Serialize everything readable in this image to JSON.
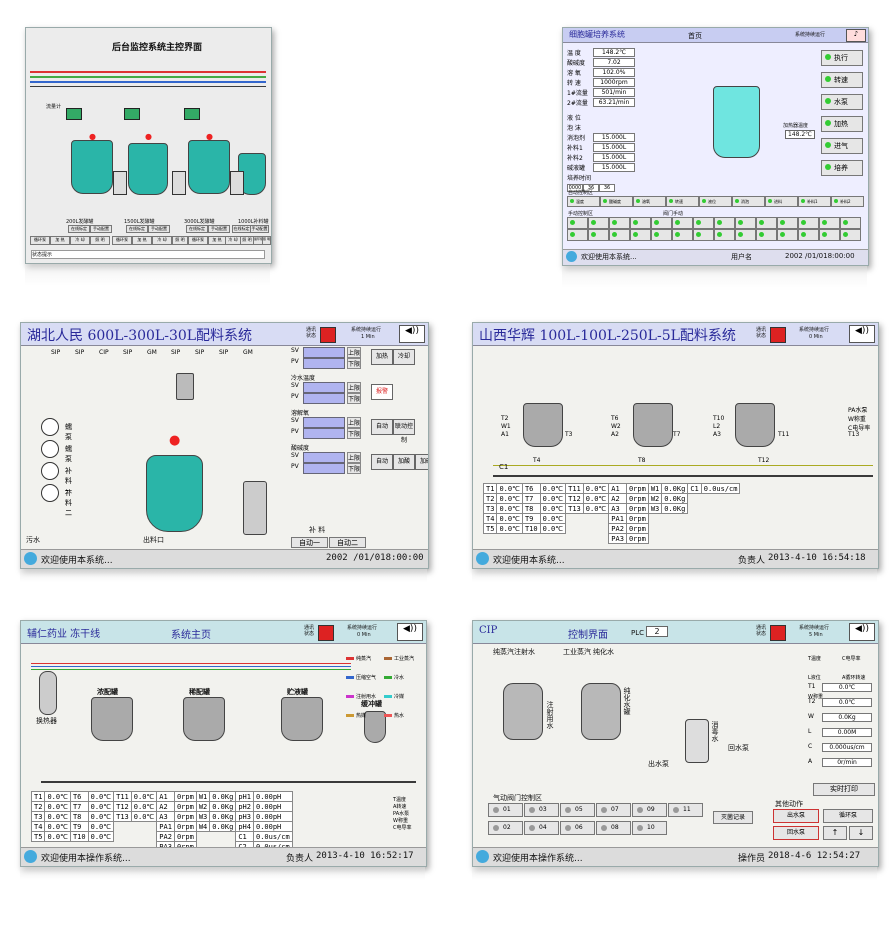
{
  "colors": {
    "accent": "#2a2a9a",
    "tank_liquid": "#2ab5a8",
    "pipe": "#3a3a3a",
    "alarm": "#e22"
  },
  "p1": {
    "title": "后台监控系统主控界面",
    "tanks": [
      {
        "name": "200L发酵罐",
        "opts": [
          "在线标定",
          "手动配置"
        ],
        "ctrls": [
          "循环泵",
          "加 热",
          "冷 却",
          "照 明"
        ]
      },
      {
        "name": "1500L发酵罐",
        "opts": [
          "在线标定",
          "手动配置"
        ],
        "ctrls": [
          "循环泵",
          "加 热",
          "冷 却",
          "照 明"
        ]
      },
      {
        "name": "3000L发酵罐",
        "opts": [
          "在线标定",
          "手动配置"
        ],
        "ctrls": [
          "循环泵",
          "加 热",
          "冷 却",
          "照 明"
        ]
      },
      {
        "name": "1000L补料罐",
        "opts": [
          "在线标定",
          "手动配置"
        ],
        "ctrls": [
          "循环泵",
          "照 明"
        ]
      }
    ],
    "flowmeter": "流量计",
    "status": "状态提示"
  },
  "p2": {
    "title": "细胞罐培养系统",
    "home": "首页",
    "run": "系统持续运行",
    "params": [
      [
        "温 度",
        "148.2℃"
      ],
      [
        "酸碱度",
        "7.02"
      ],
      [
        "溶 氧",
        "102.0%"
      ],
      [
        "转 速",
        "1000rpm"
      ],
      [
        "1#流量",
        "501/min"
      ],
      [
        "2#流量",
        "63.21/min"
      ]
    ],
    "params2": [
      [
        "液 位",
        ""
      ],
      [
        "泡 沫",
        ""
      ],
      [
        "消泡剂",
        "15.000L"
      ],
      [
        "补料1",
        "15.000L"
      ],
      [
        "补料2",
        "15.000L"
      ],
      [
        "碱液罐",
        "15.000L"
      ],
      [
        "培养时间",
        ""
      ]
    ],
    "time": [
      "0000",
      "36",
      "36"
    ],
    "gas": [
      "N₂",
      "O₂",
      "CO₂",
      "Air1",
      "Air2"
    ],
    "heat_label": "加热器温度",
    "heat_val": "148.2℃",
    "side": [
      "执行",
      "转速",
      "水泵",
      "加热",
      "进气",
      "培养"
    ],
    "auto_label": "自动控制区",
    "manual_label": "手动控制区",
    "valve_label": "阀门手动",
    "auto_items": [
      "温度",
      "酸碱度",
      "溶氧",
      "转速",
      "液位",
      "消泡",
      "进料",
      "补料1",
      "补料2"
    ],
    "status_l": "欢迎使用本系统...",
    "user": "用户名",
    "datetime": "2002 /01/018:00:00"
  },
  "p3": {
    "title": "湖北人民  600L-300L-30L配料系统",
    "comm": "通讯状态",
    "run": "系统持续运行",
    "run_min": "1 Min",
    "pumps": [
      "蠕 泵",
      "蠕 泵",
      "补料一",
      "补料二"
    ],
    "outlet": "出料口",
    "sewage": "污水",
    "labels": [
      "SIP",
      "SIP",
      "CIP",
      "SIP",
      "GM",
      "SIP",
      "SIP",
      "SIP",
      "GM"
    ],
    "rows": [
      {
        "title": "",
        "fields": [
          "SV",
          "PV"
        ],
        "lim": [
          "上限",
          "下限"
        ],
        "btns": [
          "加热",
          "冷却"
        ]
      },
      {
        "title": "冷水温度",
        "fields": [
          "SV",
          "PV"
        ],
        "lim": [
          "上限",
          "下限"
        ],
        "btns": [
          "报警"
        ]
      },
      {
        "title": "溶解氧",
        "fields": [
          "SV",
          "PV"
        ],
        "lim": [
          "上限",
          "下限"
        ],
        "btns": [
          "自动",
          "联动控制"
        ]
      },
      {
        "title": "酸碱度",
        "fields": [
          "SV",
          "PV"
        ],
        "lim": [
          "上限",
          "下限"
        ],
        "btns": [
          "自动",
          "加酸",
          "加碱"
        ]
      }
    ],
    "feed": "补 料",
    "auto1": "自动一",
    "auto2": "自动二",
    "status_l": "欢迎使用本系统...",
    "datetime": "2002 /01/018:00:00"
  },
  "p4": {
    "title": "山西华辉 100L-100L-250L-5L配料系统",
    "comm": "通讯状态",
    "run": "系统持续运行",
    "run_min": "0 Min",
    "tanks": [
      [
        "T2",
        "W1",
        "A1"
      ],
      [
        "T6",
        "W2",
        "A2"
      ],
      [
        "T10",
        "L2",
        "A3"
      ]
    ],
    "temps": [
      "T3",
      "T4",
      "T7",
      "T8",
      "T11",
      "T12",
      "T13"
    ],
    "legend": [
      "PA水泵",
      "W称重",
      "C电导率"
    ],
    "c_label": "C1",
    "tbl": [
      [
        "T1",
        "0.0℃",
        "T6",
        "0.0℃",
        "T11",
        "0.0℃",
        "A1",
        "0rpm",
        "W1",
        "0.0Kg",
        "C1",
        "0.0us/cm"
      ],
      [
        "T2",
        "0.0℃",
        "T7",
        "0.0℃",
        "T12",
        "0.0℃",
        "A2",
        "0rpm",
        "W2",
        "0.0Kg",
        "",
        ""
      ],
      [
        "T3",
        "0.0℃",
        "T8",
        "0.0℃",
        "T13",
        "0.0℃",
        "A3",
        "0rpm",
        "W3",
        "0.0Kg",
        "",
        ""
      ],
      [
        "T4",
        "0.0℃",
        "T9",
        "0.0℃",
        "",
        "",
        "PA1",
        "0rpm",
        "",
        "",
        "",
        ""
      ],
      [
        "T5",
        "0.0℃",
        "T10",
        "0.0℃",
        "",
        "",
        "PA2",
        "0rpm",
        "",
        "",
        "",
        ""
      ],
      [
        "",
        "",
        "",
        "",
        "",
        "",
        "PA3",
        "0rpm",
        "",
        "",
        "",
        ""
      ]
    ],
    "status_l": "欢迎使用本系统...",
    "resp": "负责人",
    "datetime": "2013-4-10  16:54:18"
  },
  "p5": {
    "title": "辅仁药业 冻干线",
    "subtitle": "系统主页",
    "comm": "通讯状态",
    "run": "系统持续运行",
    "run_min": "0 Min",
    "tanks": [
      "浓配罐",
      "稀配罐",
      "贮液罐",
      "缓冲罐"
    ],
    "heat": "换热器",
    "legend": [
      "纯蒸汽",
      "工业蒸汽",
      "压缩空气",
      "冷水",
      "注射用水",
      "冷媒",
      "热媒",
      "热水"
    ],
    "side": [
      "T温度",
      "A转速",
      "PA水泵",
      "W称重",
      "C电导率"
    ],
    "tbl": [
      [
        "T1",
        "0.0℃",
        "T6",
        "0.0℃",
        "T11",
        "0.0℃",
        "A1",
        "0rpm",
        "W1",
        "0.0Kg",
        "pH1",
        "0.00pH"
      ],
      [
        "T2",
        "0.0℃",
        "T7",
        "0.0℃",
        "T12",
        "0.0℃",
        "A2",
        "0rpm",
        "W2",
        "0.0Kg",
        "pH2",
        "0.00pH"
      ],
      [
        "T3",
        "0.0℃",
        "T8",
        "0.0℃",
        "T13",
        "0.0℃",
        "A3",
        "0rpm",
        "W3",
        "0.0Kg",
        "pH3",
        "0.00pH"
      ],
      [
        "T4",
        "0.0℃",
        "T9",
        "0.0℃",
        "",
        "",
        "PA1",
        "0rpm",
        "W4",
        "0.0Kg",
        "pH4",
        "0.00pH"
      ],
      [
        "T5",
        "0.0℃",
        "T10",
        "0.0℃",
        "",
        "",
        "PA2",
        "0rpm",
        "",
        "",
        "C1",
        "0.0us/cm"
      ],
      [
        "",
        "",
        "",
        "",
        "",
        "",
        "PA3",
        "0rpm",
        "",
        "",
        "C2",
        "0.0us/cm"
      ]
    ],
    "status_l": "欢迎使用本操作系统...",
    "resp": "负责人",
    "datetime": "2013-4-10  16:52:17"
  },
  "p6": {
    "title": "CIP",
    "subtitle": "控制界面",
    "plc": "PLC",
    "plc_val": "2",
    "comm": "通讯状态",
    "run": "系统持续运行",
    "run_min": "5 Min",
    "inputs": [
      "纯蒸汽注射水",
      "工业蒸汽",
      "纯化水"
    ],
    "tanks": [
      "注射用水",
      "纯化水罐",
      "消毒水"
    ],
    "pump": "出水泵",
    "return": "回水泵",
    "legend": [
      "T温度",
      "C电导率",
      "L液位",
      "A循环转速",
      "W称重"
    ],
    "vals": [
      [
        "T1",
        "0.0℃"
      ],
      [
        "T2",
        "0.0℃"
      ],
      [
        "W",
        "0.0Kg"
      ],
      [
        "L",
        "0.00M"
      ],
      [
        "C",
        "0.000us/cm"
      ],
      [
        "A",
        "0r/min"
      ]
    ],
    "print": "实时打印",
    "valve_area": "气动阀门控制区",
    "valves1": [
      "01",
      "03",
      "05",
      "07",
      "09",
      "11"
    ],
    "valves2": [
      "02",
      "04",
      "06",
      "08",
      "10"
    ],
    "alarm": "灭菌记录",
    "other": "其他动作",
    "o_btns": [
      "出水泵",
      "循环泵",
      "回水泵"
    ],
    "status_l": "欢迎使用本操作系统...",
    "op": "操作员",
    "datetime": "2018-4-6    12:54:27"
  }
}
